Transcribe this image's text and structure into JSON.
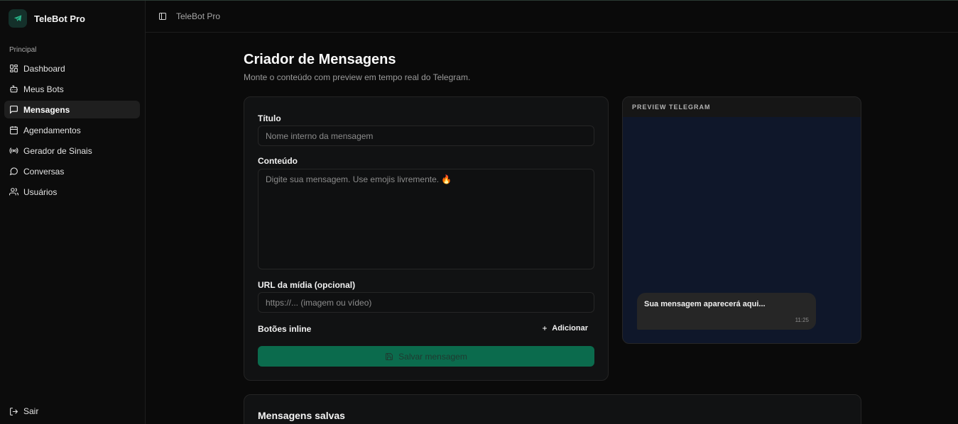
{
  "app": {
    "name": "TeleBot Pro",
    "top_title": "TeleBot Pro"
  },
  "sidebar": {
    "section_label": "Principal",
    "items": [
      {
        "label": "Dashboard",
        "icon": "dashboard-icon"
      },
      {
        "label": "Meus Bots",
        "icon": "bot-icon"
      },
      {
        "label": "Mensagens",
        "icon": "message-square-icon",
        "active": true
      },
      {
        "label": "Agendamentos",
        "icon": "calendar-icon"
      },
      {
        "label": "Gerador de Sinais",
        "icon": "radio-icon"
      },
      {
        "label": "Conversas",
        "icon": "message-circle-icon"
      },
      {
        "label": "Usuários",
        "icon": "users-icon"
      }
    ],
    "logout_label": "Sair"
  },
  "page": {
    "title": "Criador de Mensagens",
    "subtitle": "Monte o conteúdo com preview em tempo real do Telegram."
  },
  "form": {
    "title_label": "Título",
    "title_placeholder": "Nome interno da mensagem",
    "content_label": "Conteúdo",
    "content_placeholder": "Digite sua mensagem. Use emojis livremente. 🔥",
    "media_label": "URL da mídia (opcional)",
    "media_placeholder": "https://... (imagem ou vídeo)",
    "inline_buttons_label": "Botões inline",
    "add_label": "Adicionar",
    "save_label": "Salvar mensagem"
  },
  "preview": {
    "header": "PREVIEW TELEGRAM",
    "bubble_text": "Sua mensagem aparecerá aqui...",
    "time": "11:25"
  },
  "saved": {
    "title": "Mensagens salvas"
  },
  "colors": {
    "accent": "#0b6b4d",
    "preview_bg": "#0f172a",
    "background": "#0a0a0a"
  }
}
